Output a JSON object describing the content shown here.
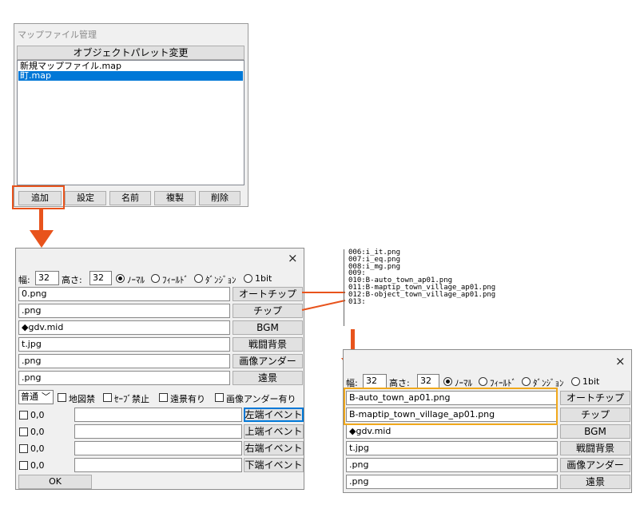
{
  "map_manager": {
    "title": "マップファイル管理",
    "palette_button": "オブジェクトパレット変更",
    "files": [
      "新規マップファイル.map",
      "町.map"
    ],
    "buttons": [
      "追加",
      "設定",
      "名前",
      "複製",
      "削除"
    ]
  },
  "dialog": {
    "close": "×",
    "width_label": "幅:",
    "width_value": "32",
    "height_label": "高さ:",
    "height_value": "32",
    "modes": [
      "ﾉｰﾏﾙ",
      "ﾌｨｰﾙﾄﾞ",
      "ﾀﾞﾝｼﾞｮﾝ",
      "1bit"
    ],
    "selected_mode": 0,
    "rows": [
      {
        "value": "0.png",
        "button": "オートチップ"
      },
      {
        "value": ".png",
        "button": "チップ"
      },
      {
        "value": "◆gdv.mid",
        "button": "BGM"
      },
      {
        "value": "t.jpg",
        "button": "戦闘背景"
      },
      {
        "value": ".png",
        "button": "画像アンダー"
      },
      {
        "value": ".png",
        "button": "遠景"
      }
    ],
    "type_select": "普通",
    "options": [
      "地図禁",
      "ｾｰﾌﾞ禁止",
      "遠景有り",
      "画像アンダー有り"
    ],
    "events": [
      {
        "coord": "0,0",
        "button": "左端イベント"
      },
      {
        "coord": "0,0",
        "button": "上端イベント"
      },
      {
        "coord": "0,0",
        "button": "右端イベント"
      },
      {
        "coord": "0,0",
        "button": "下端イベント"
      }
    ],
    "ok": "OK"
  },
  "listing": [
    "006:i_it.png",
    "007:i_eq.png",
    "008:i_mg.png",
    "009:",
    "010:B-auto_town_ap01.png",
    "011:B-maptip_town_village_ap01.png",
    "012:B-object_town_village_ap01.png",
    "013:"
  ],
  "dialog2": {
    "rows": [
      {
        "value": "B-auto_town_ap01.png",
        "button": "オートチップ"
      },
      {
        "value": "B-maptip_town_village_ap01.png",
        "button": "チップ"
      },
      {
        "value": "◆gdv.mid",
        "button": "BGM"
      },
      {
        "value": "t.jpg",
        "button": "戦闘背景"
      },
      {
        "value": ".png",
        "button": "画像アンダー"
      },
      {
        "value": ".png",
        "button": "遠景"
      }
    ]
  },
  "colors": {
    "annotation_red": "#e8531c",
    "annotation_orange": "#f0a81c",
    "selection": "#0078d7"
  }
}
